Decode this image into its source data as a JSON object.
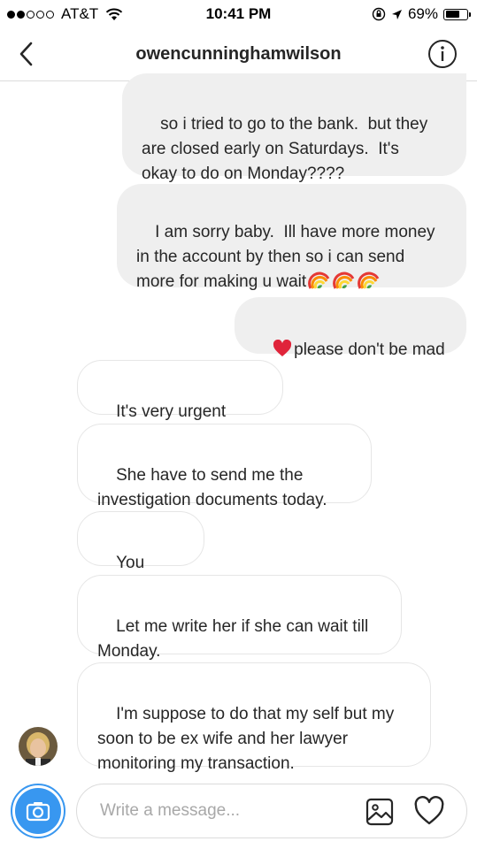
{
  "status_bar": {
    "carrier": "AT&T",
    "time": "10:41 PM",
    "battery": "69%",
    "battery_level": 0.69
  },
  "header": {
    "title": "owencunninghamwilson",
    "back_icon": "chevron-left-icon",
    "info_icon": "info-icon"
  },
  "messages": [
    {
      "direction": "outgoing",
      "text": "so i tried to go to the bank.  but they\nare closed early on Saturdays.  It's\nokay to do on Monday????"
    },
    {
      "direction": "outgoing",
      "text": "I am sorry baby.  Ill have more money\nin the account by then so i can send\nmore for making u wait",
      "emoji": "rainbow x3"
    },
    {
      "direction": "outgoing",
      "text": "please don't be mad",
      "emoji": "red-heart"
    },
    {
      "direction": "incoming",
      "text": "It's very urgent okay"
    },
    {
      "direction": "incoming",
      "text": "She have to send me the\ninvestigation documents today."
    },
    {
      "direction": "incoming",
      "text": "You there?"
    },
    {
      "direction": "incoming",
      "text": "Let me write her if she can wait till\nMonday."
    },
    {
      "direction": "incoming",
      "text": "I'm suppose to do that my self but my\nsoon to be ex wife and her lawyer\nmonitoring my transaction."
    }
  ],
  "composer": {
    "placeholder": "Write a message...",
    "value": ""
  },
  "colors": {
    "accent": "#3897f0",
    "outgoing_bubble": "#efefef",
    "incoming_border": "#e6e6e6",
    "heart_red": "#e0243a"
  }
}
